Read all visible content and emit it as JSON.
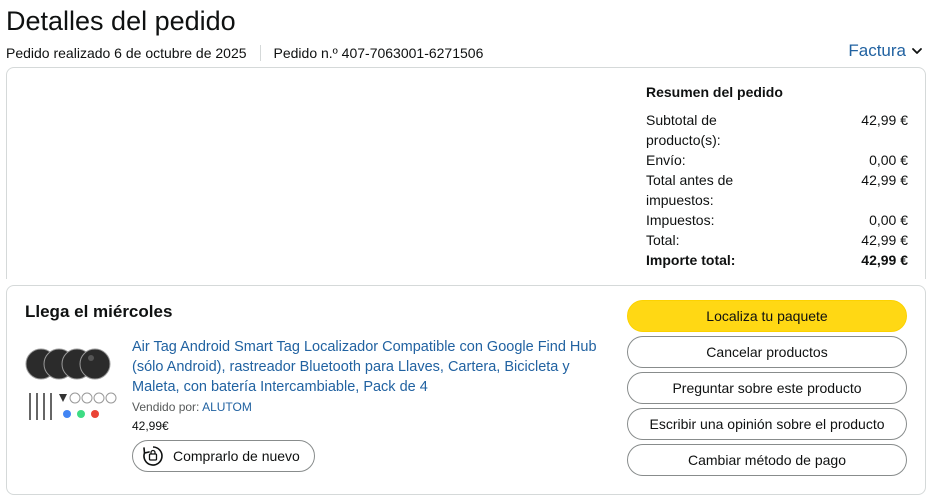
{
  "header": {
    "title": "Detalles del pedido",
    "order_date": "Pedido realizado 6 de octubre de 2025",
    "order_number": "Pedido n.º 407-7063001-6271506",
    "invoice_label": "Factura"
  },
  "summary": {
    "title": "Resumen del pedido",
    "rows": [
      {
        "label": "Subtotal de producto(s):",
        "value": "42,99 €"
      },
      {
        "label": "Envío:",
        "value": "0,00 €"
      },
      {
        "label": "Total antes de impuestos:",
        "value": "42,99 €"
      },
      {
        "label": "Impuestos:",
        "value": "0,00 €"
      },
      {
        "label": "Total:",
        "value": "42,99 €"
      },
      {
        "label": "Importe total:",
        "value": "42,99 €"
      }
    ]
  },
  "shipment": {
    "delivery_title": "Llega el miércoles",
    "product_title": "Air Tag Android Smart Tag Localizador Compatible con Google Find Hub (sólo Android), rastreador Bluetooth para Llaves, Cartera, Bicicleta y Maleta, con batería Intercambiable, Pack de 4",
    "seller_prefix": "Vendido por:",
    "seller_name": "ALUTOM",
    "price": "42,99€",
    "buy_again_label": "Comprarlo de nuevo"
  },
  "actions": {
    "track": "Localiza tu paquete",
    "cancel": "Cancelar productos",
    "ask": "Preguntar sobre este producto",
    "review": "Escribir una opinión sobre el producto",
    "payment": "Cambiar método de pago"
  },
  "colors": {
    "link": "#2162a1",
    "primary_button": "#ffd814",
    "border": "#d5d9d9"
  },
  "icons": [
    "chevron-down-icon",
    "buy-again-icon",
    "product-image"
  ]
}
